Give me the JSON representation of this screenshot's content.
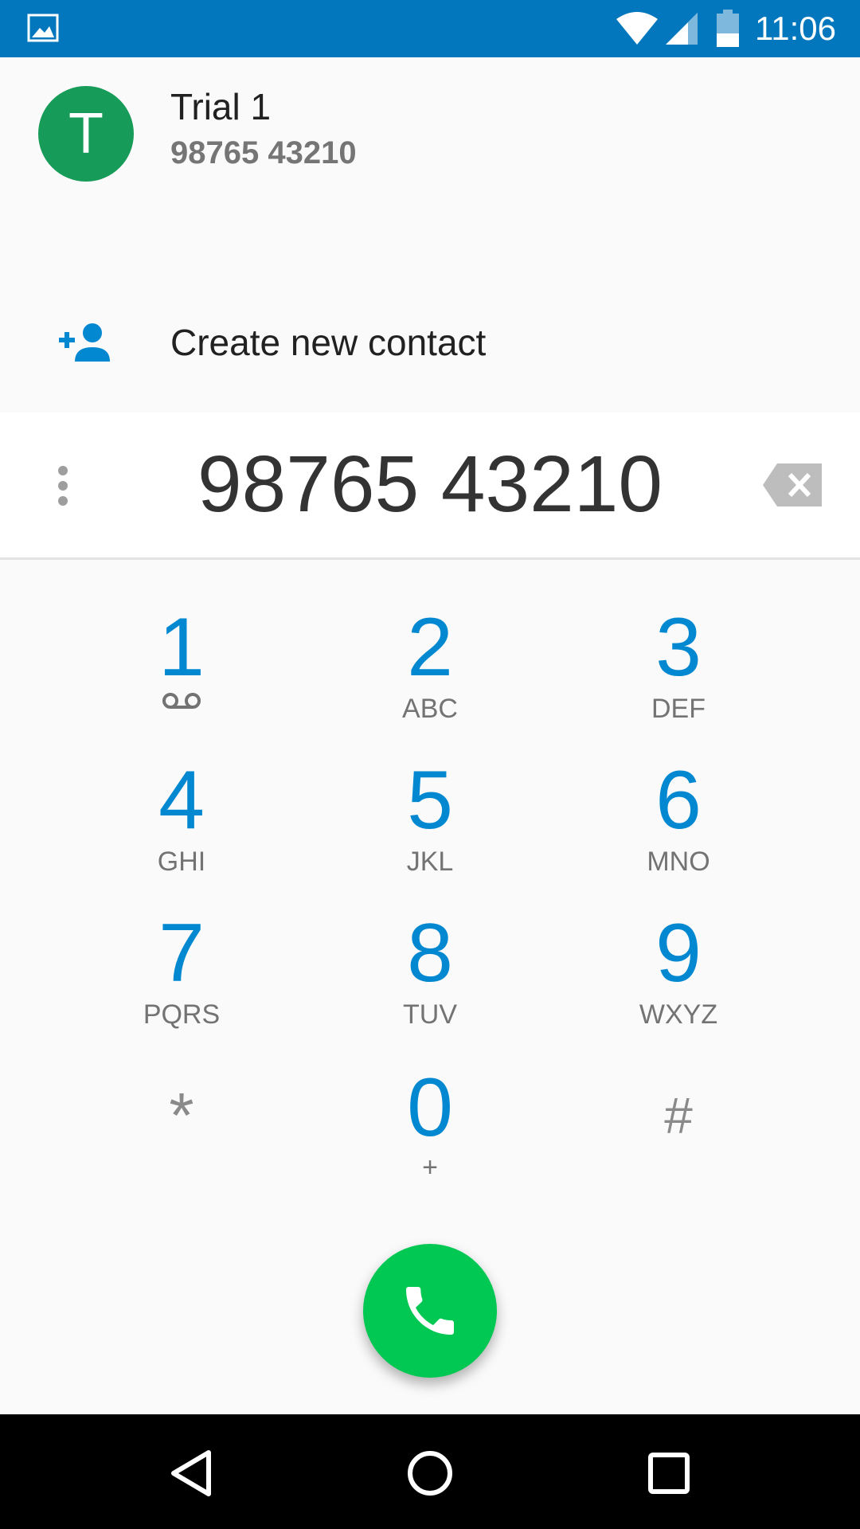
{
  "status_bar": {
    "time": "11:06",
    "icons": [
      "gallery-icon",
      "wifi-icon",
      "signal-icon",
      "battery-icon"
    ],
    "background": "#0277bd"
  },
  "suggestion": {
    "avatar_letter": "T",
    "avatar_color": "#169c58",
    "name": "Trial 1",
    "number": "98765 43210"
  },
  "create_contact": {
    "label": "Create new contact",
    "icon": "add-person-icon",
    "icon_color": "#0288d1"
  },
  "dialer": {
    "entered_number": "98765 43210",
    "accent": "#0288d1",
    "keys": [
      {
        "digit": "1",
        "letters": ""
      },
      {
        "digit": "2",
        "letters": "ABC"
      },
      {
        "digit": "3",
        "letters": "DEF"
      },
      {
        "digit": "4",
        "letters": "GHI"
      },
      {
        "digit": "5",
        "letters": "JKL"
      },
      {
        "digit": "6",
        "letters": "MNO"
      },
      {
        "digit": "7",
        "letters": "PQRS"
      },
      {
        "digit": "8",
        "letters": "TUV"
      },
      {
        "digit": "9",
        "letters": "WXYZ"
      },
      {
        "digit": "*",
        "letters": ""
      },
      {
        "digit": "0",
        "letters": "+"
      },
      {
        "digit": "#",
        "letters": ""
      }
    ],
    "call_button_color": "#00c853"
  },
  "nav_bar": {
    "buttons": [
      "back-icon",
      "home-icon",
      "recents-icon"
    ]
  }
}
